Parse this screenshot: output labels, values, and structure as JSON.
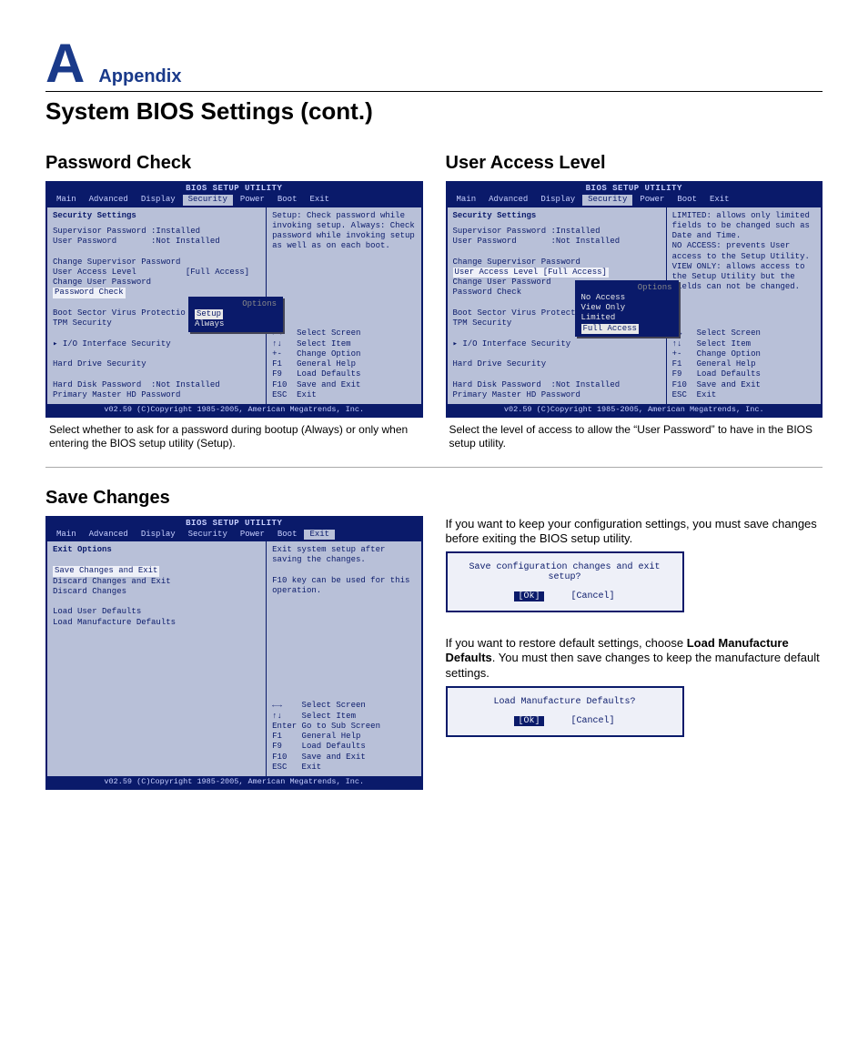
{
  "appendix": {
    "letter": "A",
    "label": "Appendix"
  },
  "page_title": "System BIOS Settings (cont.)",
  "bios_common": {
    "title": "BIOS SETUP UTILITY",
    "menu": [
      "Main",
      "Advanced",
      "Display",
      "Security",
      "Power",
      "Boot",
      "Exit"
    ],
    "footer": "v02.59 (C)Copyright 1985-2005, American Megatrends, Inc.",
    "keys_security": [
      "←→   Select Screen",
      "↑↓   Select Item",
      "+-   Change Option",
      "F1   General Help",
      "F9   Load Defaults",
      "F10  Save and Exit",
      "ESC  Exit"
    ],
    "keys_exit": [
      "←→    Select Screen",
      "↑↓    Select Item",
      "Enter Go to Sub Screen",
      "F1    General Help",
      "F9    Load Defaults",
      "F10   Save and Exit",
      "ESC   Exit"
    ]
  },
  "password_check": {
    "heading": "Password Check",
    "active_menu": "Security",
    "left_heading": "Security Settings",
    "lines": [
      "Supervisor Password :Installed",
      "User Password       :Not Installed",
      "",
      "Change Supervisor Password",
      "User Access Level          [Full Access]",
      "Change User Password"
    ],
    "selected_line": "Password Check",
    "after_selected": [
      "",
      "Boot Sector Virus Protectio",
      "TPM Security",
      "",
      "▸ I/O Interface Security",
      "",
      "Hard Drive Security",
      "",
      "Hard Disk Password  :Not Installed",
      "Primary Master HD Password"
    ],
    "popup_title": "Options",
    "popup_items": [
      "Setup",
      "Always"
    ],
    "popup_selected": "Setup",
    "help": "Setup: Check password while invoking setup. Always: Check password while invoking setup as well as on each boot.",
    "caption": "Select whether to ask for a password during bootup (Always) or only when entering the BIOS setup utility (Setup)."
  },
  "user_access": {
    "heading": "User Access Level",
    "active_menu": "Security",
    "left_heading": "Security Settings",
    "lines": [
      "Supervisor Password :Installed",
      "User Password       :Not Installed",
      "",
      "Change Supervisor Password"
    ],
    "selected_line": "User Access Level          [Full Access]",
    "after_selected": [
      "Change User Password",
      "Password Check",
      "",
      "Boot Sector Virus Protectio",
      "TPM Security",
      "",
      "▸ I/O Interface Security",
      "",
      "Hard Drive Security",
      "",
      "Hard Disk Password  :Not Installed",
      "Primary Master HD Password"
    ],
    "popup_title": "Options",
    "popup_items": [
      "No Access",
      "View Only",
      "Limited",
      "Full Access"
    ],
    "popup_selected": "Full Access",
    "help": "LIMITED: allows only limited fields to be changed such as Date and Time.\nNO ACCESS: prevents User access to the Setup Utility.\nVIEW ONLY: allows access to the Setup Utility but the fields can not be changed.",
    "caption": "Select the level of access to allow the “User Password” to have in the BIOS setup utility."
  },
  "save_changes": {
    "heading": "Save Changes",
    "active_menu": "Exit",
    "left_heading": "Exit Options",
    "selected_line": "Save Changes and Exit",
    "after_selected": [
      "Discard Changes and Exit",
      "Discard Changes",
      "",
      "Load User Defaults",
      "Load Manufacture Defaults"
    ],
    "help": "Exit system setup after saving the changes.\n\nF10 key can be used for this operation.",
    "right_para1": "If you want to keep your configuration settings, you must save changes before exiting the BIOS setup utility.",
    "right_para2_pre": "If you want to restore default settings, choose ",
    "right_para2_bold": "Load Manufacture Defaults",
    "right_para2_post": ". You must then save changes to keep the manufacture default settings.",
    "dialog1_msg": "Save configuration changes and exit setup?",
    "dialog2_msg": "Load Manufacture Defaults?",
    "dialog_ok": "[Ok]",
    "dialog_cancel": "[Cancel]"
  }
}
